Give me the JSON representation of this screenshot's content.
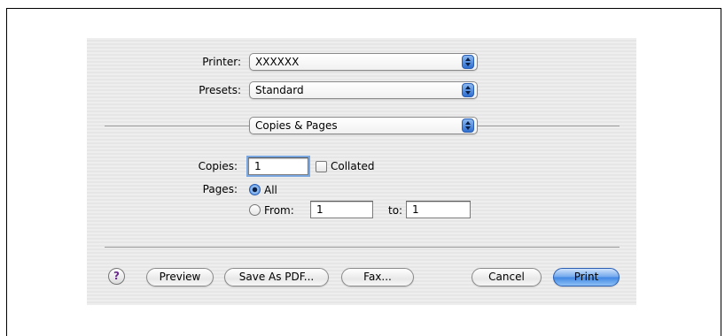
{
  "printer": {
    "label": "Printer:",
    "value": "XXXXXX"
  },
  "presets": {
    "label": "Presets:",
    "value": "Standard"
  },
  "panel": {
    "value": "Copies & Pages"
  },
  "copies": {
    "label": "Copies:",
    "value": "1",
    "collated_label": "Collated",
    "collated_checked": false
  },
  "pages": {
    "label": "Pages:",
    "all_label": "All",
    "all_selected": true,
    "from_label": "From:",
    "from_value": "1",
    "to_label": "to:",
    "to_value": "1"
  },
  "buttons": {
    "help": "?",
    "preview": "Preview",
    "save_as_pdf": "Save As PDF...",
    "fax": "Fax...",
    "cancel": "Cancel",
    "print": "Print"
  }
}
